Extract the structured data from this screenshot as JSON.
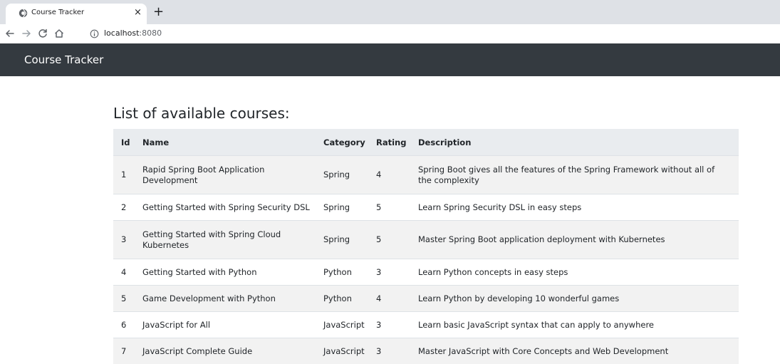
{
  "browser": {
    "tab_title": "Course Tracker",
    "tab_close": "×",
    "new_tab": "+",
    "address_host": "localhost",
    "address_port": ":8080"
  },
  "navbar": {
    "brand": "Course Tracker"
  },
  "main": {
    "title": "List of available courses:",
    "columns": [
      "Id",
      "Name",
      "Category",
      "Rating",
      "Description"
    ],
    "rows": [
      {
        "id": "1",
        "name": "Rapid Spring Boot Application Development",
        "category": "Spring",
        "rating": "4",
        "description": "Spring Boot gives all the features of the Spring Framework without all of the complexity"
      },
      {
        "id": "2",
        "name": "Getting Started with Spring Security DSL",
        "category": "Spring",
        "rating": "5",
        "description": "Learn Spring Security DSL in easy steps"
      },
      {
        "id": "3",
        "name": "Getting Started with Spring Cloud Kubernetes",
        "category": "Spring",
        "rating": "5",
        "description": "Master Spring Boot application deployment with Kubernetes"
      },
      {
        "id": "4",
        "name": "Getting Started with Python",
        "category": "Python",
        "rating": "3",
        "description": "Learn Python concepts in easy steps"
      },
      {
        "id": "5",
        "name": "Game Development with Python",
        "category": "Python",
        "rating": "4",
        "description": "Learn Python by developing 10 wonderful games"
      },
      {
        "id": "6",
        "name": "JavaScript for All",
        "category": "JavaScript",
        "rating": "3",
        "description": "Learn basic JavaScript syntax that can apply to anywhere"
      },
      {
        "id": "7",
        "name": "JavaScript Complete Guide",
        "category": "JavaScript",
        "rating": "3",
        "description": "Master JavaScript with Core Concepts and Web Development"
      }
    ]
  },
  "icons": {
    "favicon": "globe-icon",
    "back": "arrow-left-icon",
    "forward": "arrow-right-icon",
    "reload": "reload-icon",
    "home": "home-icon",
    "site_info": "info-icon"
  },
  "colors": {
    "navbar_bg": "#343a40",
    "table_header_bg": "#e9ecef",
    "stripe_bg": "#f2f2f2",
    "tabstrip_bg": "#dee1e6"
  }
}
